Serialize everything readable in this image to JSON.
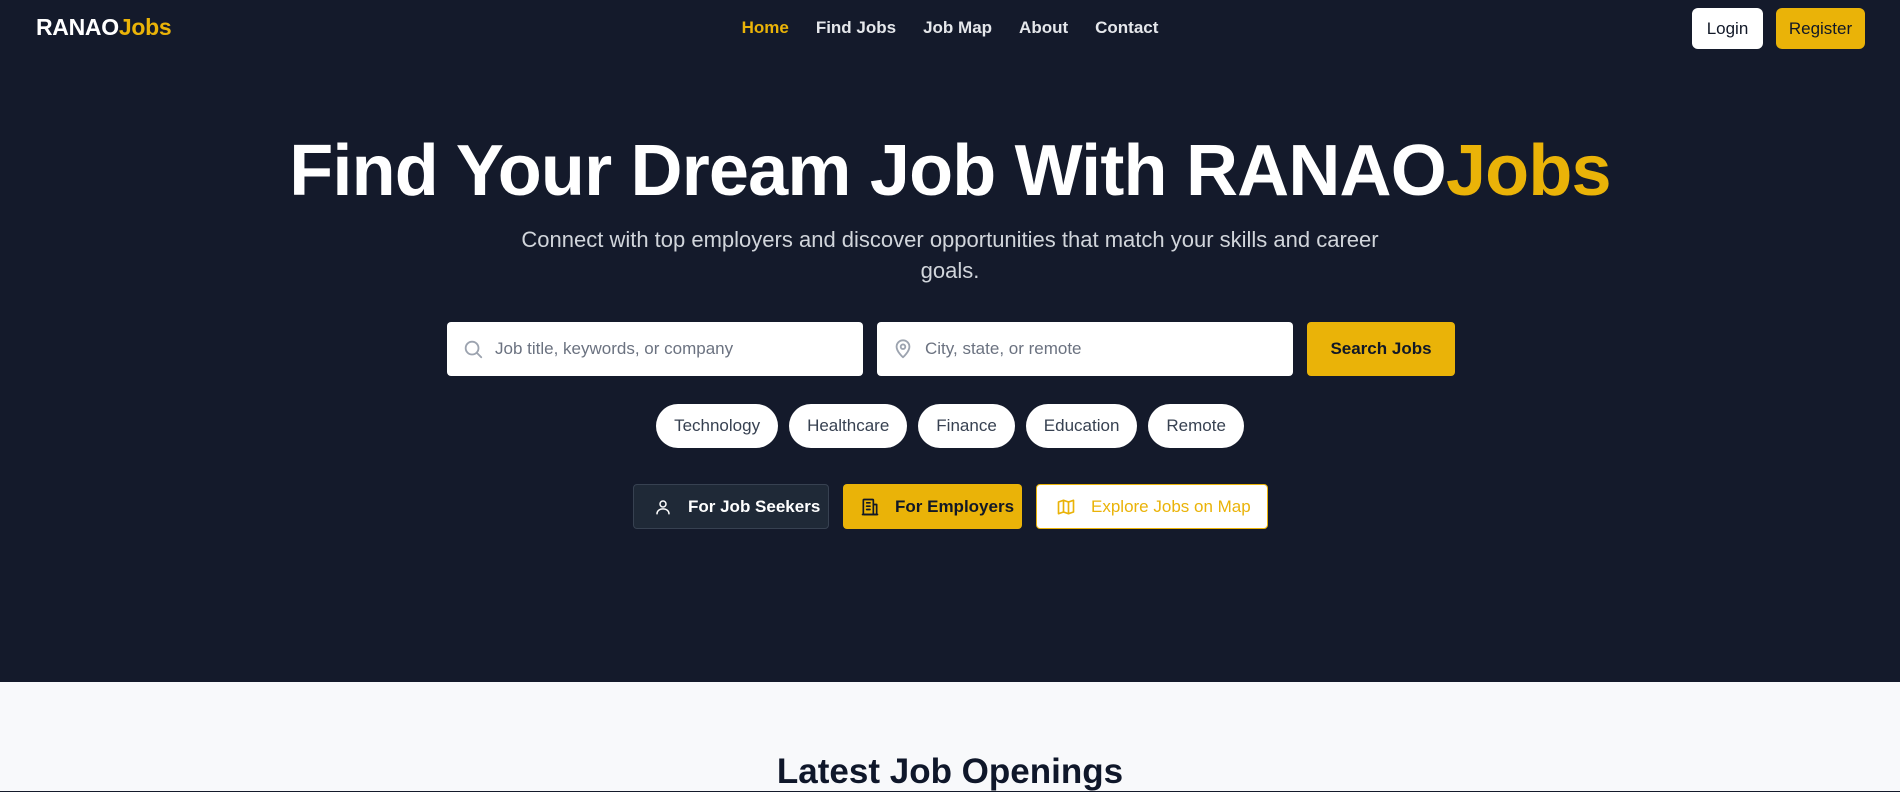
{
  "brand": {
    "name_main": "RANAO",
    "name_accent": "Jobs",
    "accent_color": "#eab308"
  },
  "nav": {
    "links": [
      {
        "label": "Home",
        "active": true
      },
      {
        "label": "Find Jobs",
        "active": false
      },
      {
        "label": "Job Map",
        "active": false
      },
      {
        "label": "About",
        "active": false
      },
      {
        "label": "Contact",
        "active": false
      }
    ],
    "login_label": "Login",
    "register_label": "Register"
  },
  "hero": {
    "headline_main": "Find Your Dream Job With RANAO",
    "headline_accent": "Jobs",
    "subtitle": "Connect with top employers and discover opportunities that match your skills and career goals.",
    "background_color": "#141a2b"
  },
  "search": {
    "keyword_placeholder": "Job title, keywords, or company",
    "location_placeholder": "City, state, or remote",
    "keyword_icon": "search-icon",
    "location_icon": "map-pin-icon",
    "button_label": "Search Jobs"
  },
  "categories": [
    "Technology",
    "Healthcare",
    "Finance",
    "Education",
    "Remote"
  ],
  "cta": {
    "seekers_label": "For Job Seekers",
    "seekers_icon": "user-icon",
    "employers_label": "For Employers",
    "employers_icon": "building-icon",
    "map_label": "Explore Jobs on Map",
    "map_icon": "map-icon"
  },
  "latest": {
    "title": "Latest Job Openings"
  }
}
